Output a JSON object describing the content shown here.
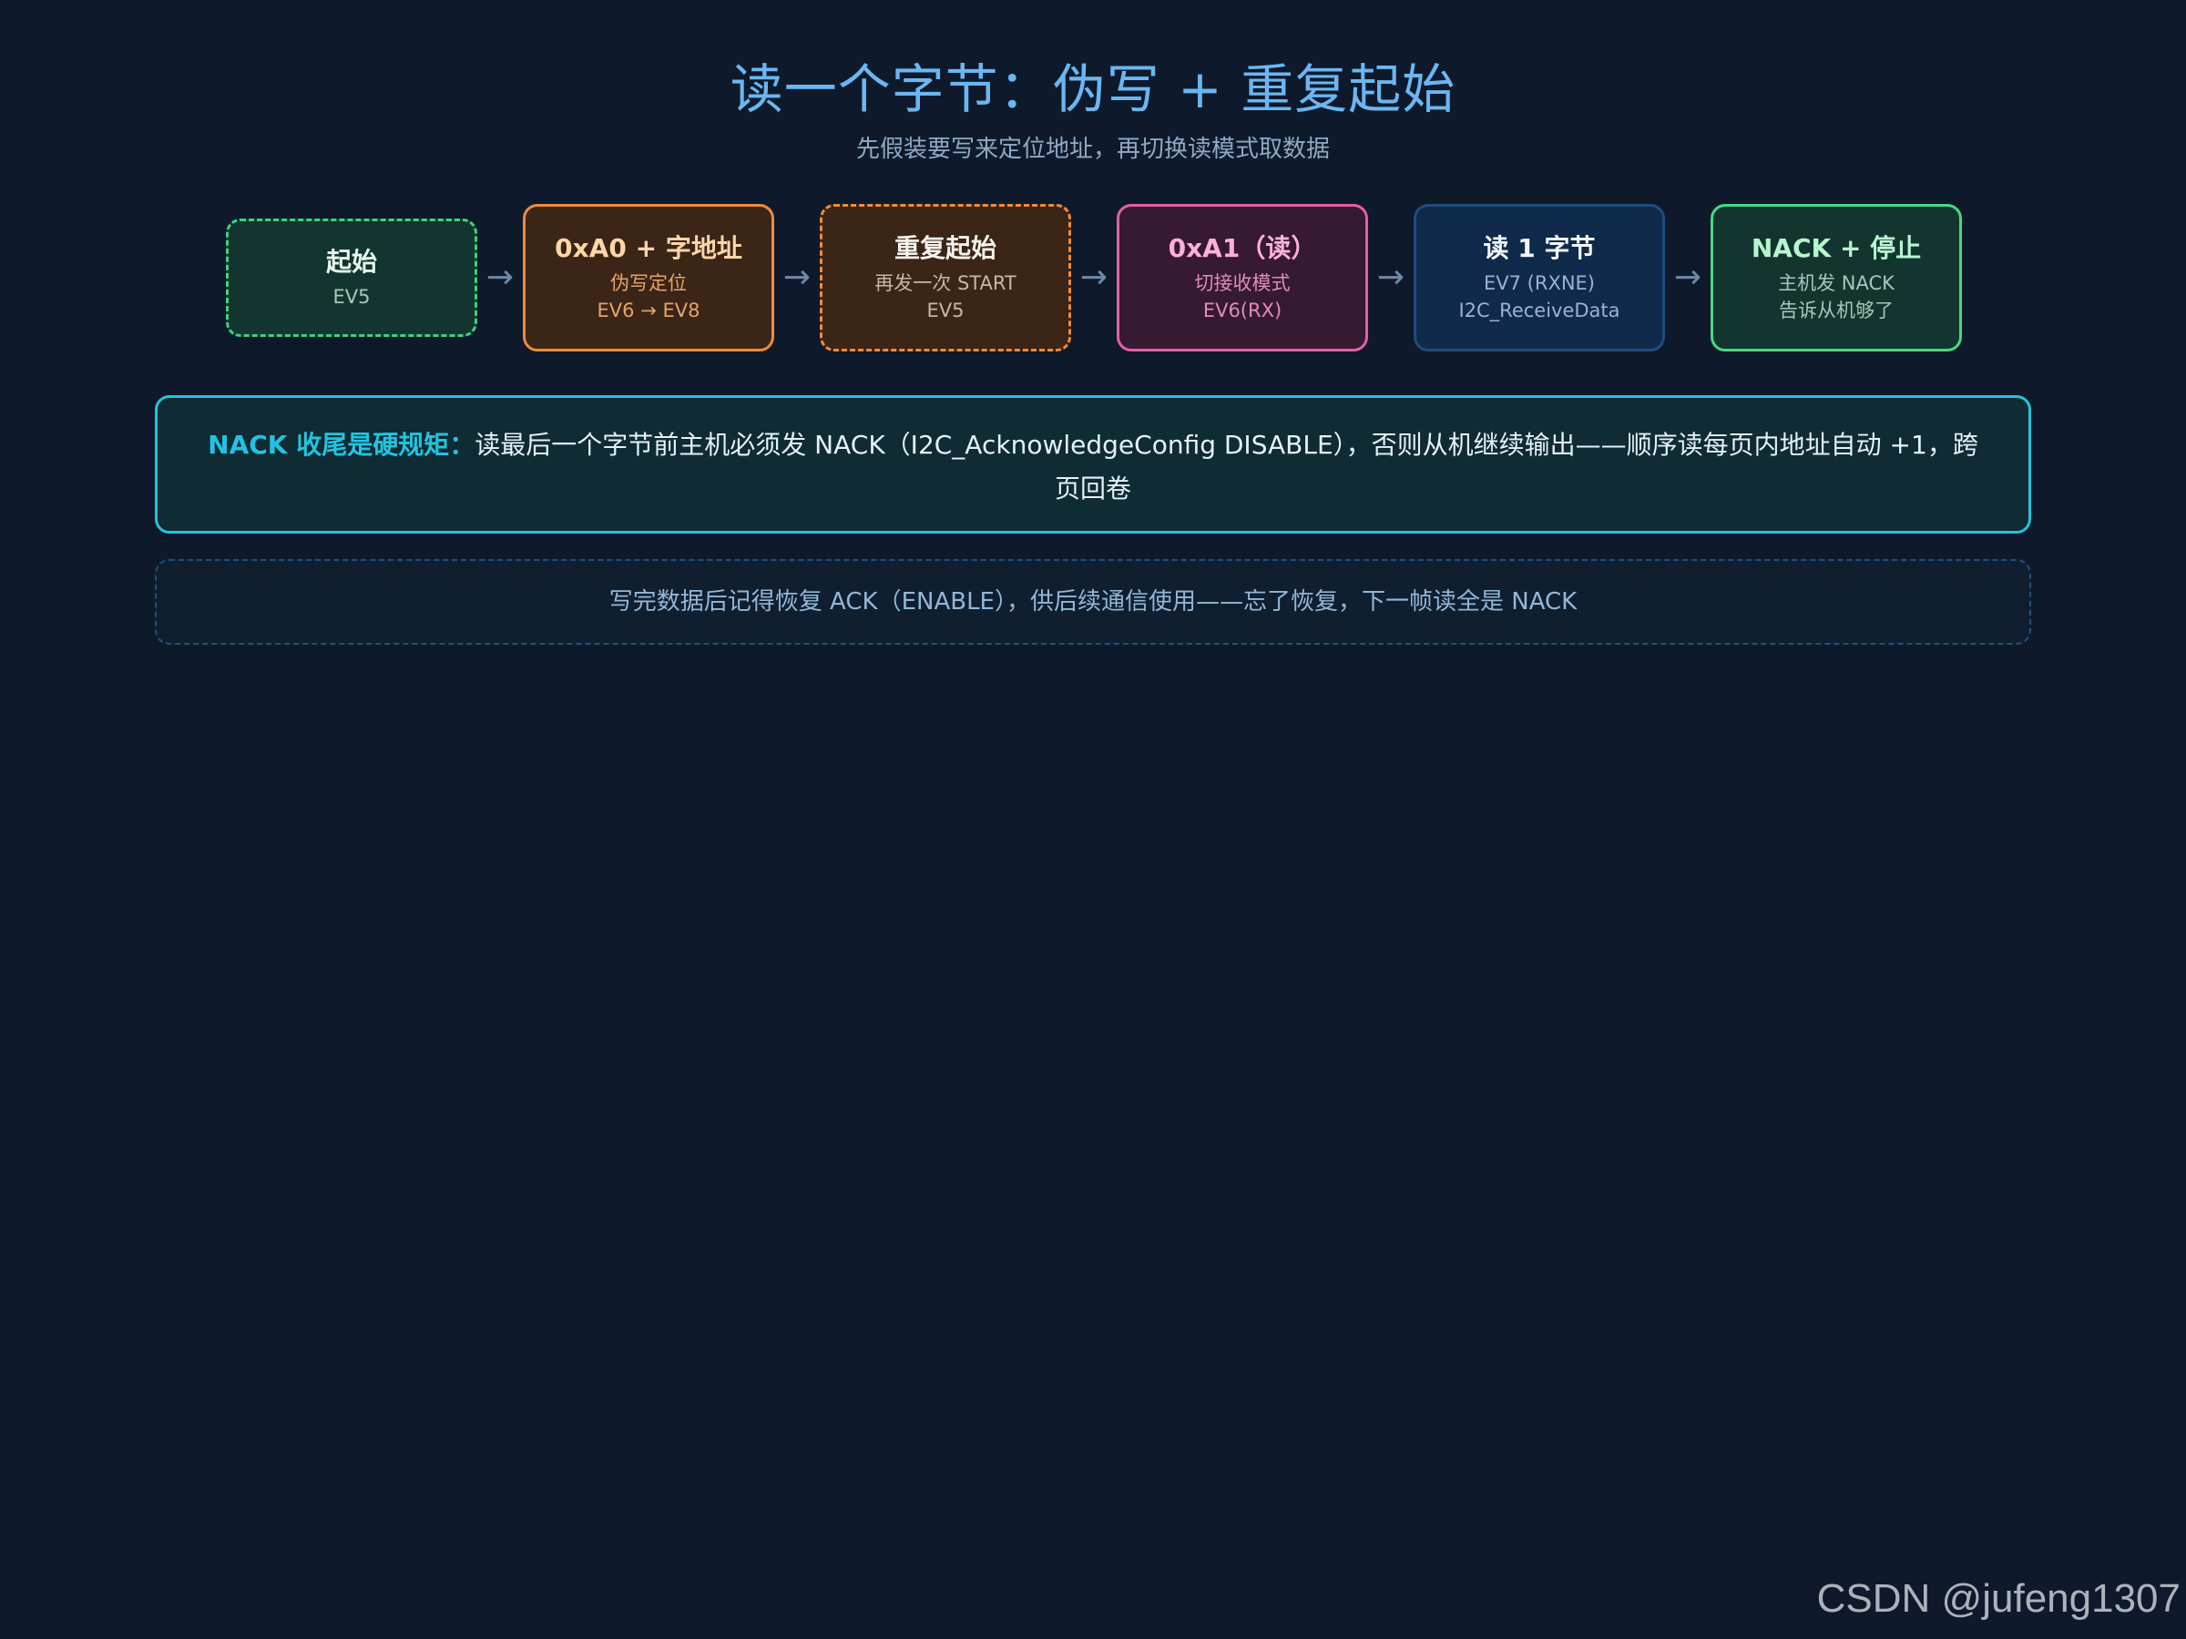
{
  "title": "读一个字节：伪写 + 重复起始",
  "subtitle": "先假装要写来定位地址，再切换读模式取数据",
  "arrow": "→",
  "steps": [
    {
      "title": "起始",
      "lines": [
        "EV5"
      ],
      "style": "dashed",
      "border": "#3fd17a",
      "bg": "#12362f",
      "title_color": "#e8f5ee",
      "text_color": "#a9c7b9"
    },
    {
      "title": "0xA0 + 字地址",
      "lines": [
        "伪写定位",
        "EV6 → EV8"
      ],
      "style": "solid",
      "border": "#f08a3c",
      "bg": "#3a2517",
      "title_color": "#ffd6a8",
      "text_color": "#e6a46a"
    },
    {
      "title": "重复起始",
      "lines": [
        "再发一次 START",
        "EV5"
      ],
      "style": "dashed",
      "border": "#f08a3c",
      "bg": "#3a2517",
      "title_color": "#f5f1ea",
      "text_color": "#c9b6a4"
    },
    {
      "title": "0xA1（读）",
      "lines": [
        "切接收模式",
        "EV6(RX)"
      ],
      "style": "solid",
      "border": "#e35fa8",
      "bg": "#351a31",
      "title_color": "#ffb0da",
      "text_color": "#e08bbd"
    },
    {
      "title": "读 1 字节",
      "lines": [
        "EV7 (RXNE)",
        "I2C_ReceiveData"
      ],
      "style": "solid",
      "border": "#1f4d7d",
      "bg": "#0f2a4a",
      "title_color": "#f2f6fb",
      "text_color": "#9ab4cf"
    },
    {
      "title": "NACK + 停止",
      "lines": [
        "主机发 NACK",
        "告诉从机够了"
      ],
      "style": "solid",
      "border": "#47d97f",
      "bg": "#12362f",
      "title_color": "#b8f5cf",
      "text_color": "#a9c7b9"
    }
  ],
  "note": {
    "label": "NACK 收尾是硬规矩：",
    "text": "读最后一个字节前主机必须发 NACK（I2C_AcknowledgeConfig DISABLE），否则从机继续输出——顺序读每页内地址自动 +1，跨页回卷"
  },
  "tip": "写完数据后记得恢复 ACK（ENABLE），供后续通信使用——忘了恢复，下一帧读全是 NACK",
  "watermark": "CSDN @jufeng1307"
}
